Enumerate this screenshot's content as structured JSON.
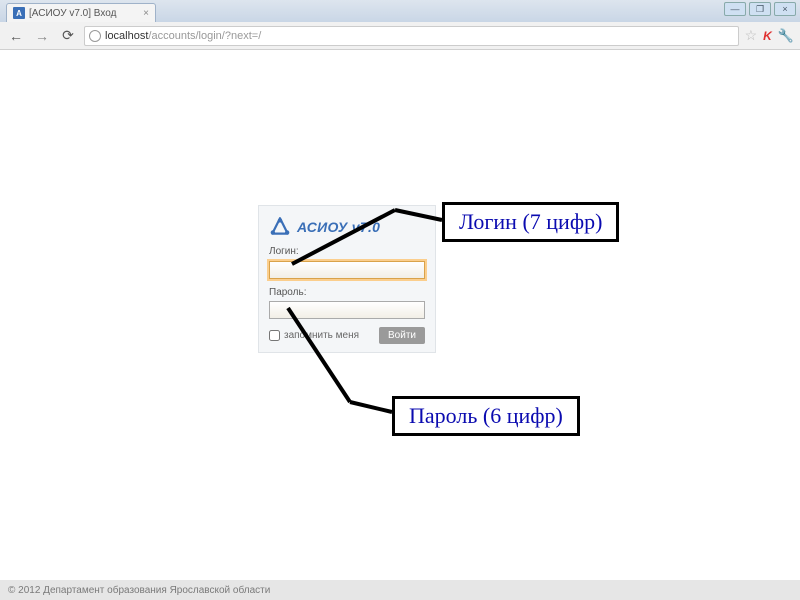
{
  "browser": {
    "tab_title": "[АСИОУ v7.0] Вход",
    "url_host": "localhost",
    "url_path": "/accounts/login/?next=/"
  },
  "login_form": {
    "app_name": "АСИОУ v7.0",
    "login_label": "Логин:",
    "password_label": "Пароль:",
    "remember_label": "запомнить меня",
    "submit_label": "Войти"
  },
  "annotations": {
    "login_hint": "Логин (7 цифр)",
    "password_hint": "Пароль (6 цифр)"
  },
  "footer": {
    "text": "© 2012 Департамент образования Ярославской области"
  }
}
